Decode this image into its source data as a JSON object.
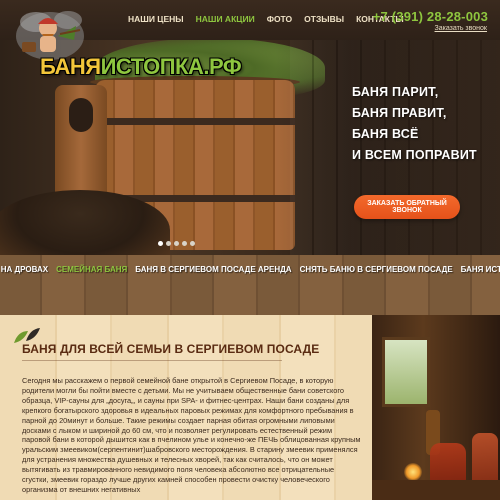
{
  "header": {
    "logo_part1": "БАНЯ",
    "logo_part2": "ИСТОПКА.РФ",
    "nav": [
      {
        "label": "НАШИ ЦЕНЫ",
        "active": false
      },
      {
        "label": "НАШИ АКЦИИ",
        "active": true
      },
      {
        "label": "ФОТО",
        "active": false
      },
      {
        "label": "ОТЗЫВЫ",
        "active": false
      },
      {
        "label": "КОНТАКТЫ",
        "active": false
      }
    ],
    "phone": "+7 (391) 28-28-003",
    "callback_link": "Заказать звонок"
  },
  "hero": {
    "slogan": [
      "БАНЯ ПАРИТ,",
      "БАНЯ ПРАВИТ,",
      "БАНЯ ВСЁ",
      "И ВСЕМ ПОПРАВИТ"
    ],
    "cta_label": "ЗАКАЗАТЬ ОБРАТНЫЙ ЗВОНОК",
    "slider_dots": 5,
    "active_dot": 0
  },
  "categories": [
    {
      "label": "БАНЯ НА ДРОВАХ",
      "active": false
    },
    {
      "label": "СЕМЕЙНАЯ БАНЯ",
      "active": true
    },
    {
      "label": "БАНЯ В СЕРГИЕВОМ ПОСАДЕ АРЕНДА",
      "active": false
    },
    {
      "label": "СНЯТЬ БАНЮ В СЕРГИЕВОМ ПОСАДЕ",
      "active": false
    },
    {
      "label": "БАНЯ ИСТОПКА",
      "active": false
    }
  ],
  "article": {
    "title": "БАНЯ ДЛЯ ВСЕЙ СЕМЬИ В СЕРГИЕВОМ ПОСАДЕ",
    "body": "Сегодня мы расскажем о первой семейной бане открытой в Сергиевом Посаде, в которую родители могли бы пойти вместе с детьми. Мы не учитываем общественные бани советского образца, VIP-сауны для „досуга„, и сауны при SPA- и фитнес-центрах. Наши бани созданы для крепкого богатырского здоровья в идеальных паровых режимах для комфортного пребывания в парной до 20минут  и больше. Такие режимы создает парная обитая огромными липовыми досками с лыком и шириной до 60 см, что и позволяет регулировать естественный режим паровой бани в которой дышится как в пчелином улье и конечно-же ПЕЧЬ облицованная крупным уральским змеевиком(серпентинит)шабровского месторождения. В старину змеевик применялся для устранения множества душевных и телесных хворей, так как считалось, что он может вытягивать из травмированного невидимого поля человека абсолютно все отрицательные сгустки, змеевик гораздо лучше других камней способен провести очистку человеческого организма от внешних негативных"
  },
  "colors": {
    "accent_green": "#8ec63f",
    "cta_orange": "#f0602a",
    "title_brown": "#5a2b12"
  }
}
